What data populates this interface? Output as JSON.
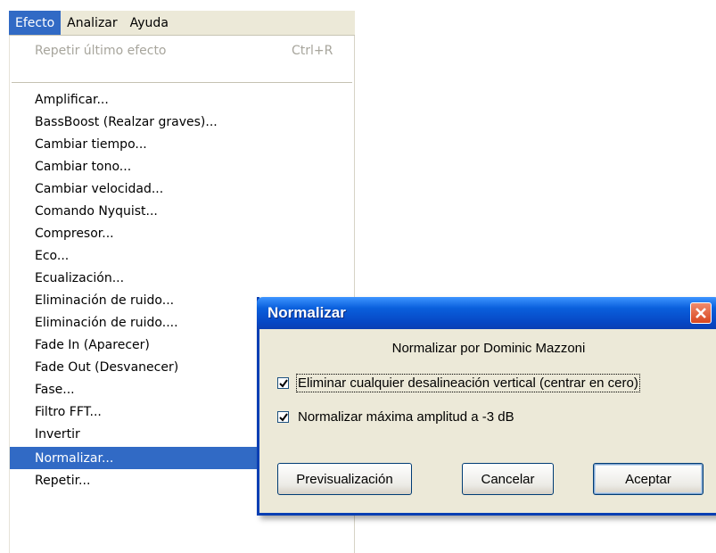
{
  "menubar": {
    "items": [
      {
        "label": "Efecto",
        "active": true
      },
      {
        "label": "Analizar"
      },
      {
        "label": "Ayuda"
      }
    ]
  },
  "menu": {
    "repeat_last": {
      "label": "Repetir último efecto",
      "shortcut": "Ctrl+R"
    },
    "items": [
      "Amplificar...",
      "BassBoost (Realzar graves)...",
      "Cambiar tiempo...",
      "Cambiar tono...",
      "Cambiar velocidad...",
      "Comando Nyquist...",
      "Compresor...",
      "Eco...",
      "Ecualización...",
      "Eliminación de ruido...",
      "Eliminación de ruido....",
      "Fade In (Aparecer)",
      "Fade Out (Desvanecer)",
      "Fase...",
      "Filtro FFT...",
      "Invertir",
      "Normalizar...",
      "Repetir..."
    ],
    "selected": "Normalizar..."
  },
  "dialog": {
    "title": "Normalizar",
    "author": "Normalizar por Dominic Mazzoni",
    "checkbox_dc": {
      "label": "Eliminar cualquier desalineación vertical (centrar en cero)",
      "checked": true
    },
    "checkbox_norm": {
      "label": "Normalizar máxima amplitud a -3 dB",
      "checked": true
    },
    "buttons": {
      "preview": "Previsualización",
      "cancel": "Cancelar",
      "ok": "Aceptar"
    }
  },
  "colors": {
    "selection": "#316ac5",
    "titlebar": "#0a5fdc",
    "dialog_bg": "#ece9d8",
    "close": "#d8461f"
  }
}
